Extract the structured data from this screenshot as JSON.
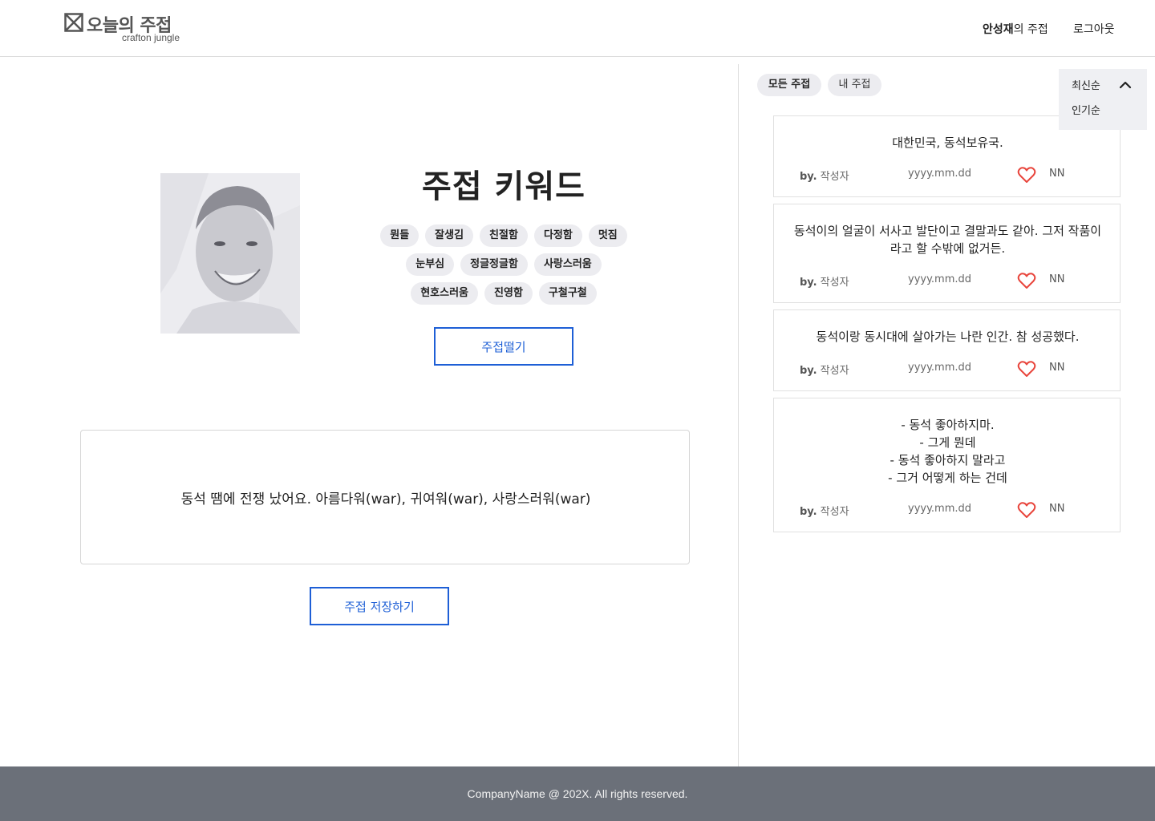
{
  "header": {
    "logo_title": "오늘의 주접",
    "logo_subtitle": "crafton jungle",
    "user_name": "안성재",
    "user_suffix": "의 주접",
    "logout_label": "로그아웃"
  },
  "main": {
    "keyword_title": "주접 키워드",
    "keyword_rows": [
      [
        "뭔들",
        "잘생김",
        "친절함",
        "다정함",
        "멋짐"
      ],
      [
        "눈부심",
        "정글정글함",
        "사랑스러움"
      ],
      [
        "현호스러움",
        "진영함",
        "구철구철"
      ]
    ],
    "generate_button": "주접떨기",
    "fortune_text": "동석  땜에 전쟁 났어요. 아름다워(war), 귀여워(war), 사랑스러워(war)",
    "save_button": "주접 저장하기"
  },
  "sidebar": {
    "tabs": [
      "모든 주접",
      "내 주접"
    ],
    "active_tab": "모든 주접",
    "sort": {
      "selected": "최신순",
      "options": [
        "최신순",
        "인기순"
      ]
    },
    "cards": [
      {
        "lines": [
          "대한민국, 동석보유국."
        ],
        "by": "by.",
        "author": "작성자",
        "date": "yyyy.mm.dd",
        "likes": "NN"
      },
      {
        "lines": [
          "동석이의 얼굴이 서사고 발단이고 결말과도 같아. 그저 작품이",
          "라고 할 수밖에 없거든."
        ],
        "by": "by.",
        "author": "작성자",
        "date": "yyyy.mm.dd",
        "likes": "NN"
      },
      {
        "lines": [
          "동석이랑 동시대에 살아가는 나란 인간. 참 성공했다."
        ],
        "by": "by.",
        "author": "작성자",
        "date": "yyyy.mm.dd",
        "likes": "NN"
      },
      {
        "lines": [
          "- 동석 좋아하지마.",
          "- 그게 뭔데",
          "- 동석 좋아하지 말라고",
          "- 그거 어떻게 하는 건데"
        ],
        "by": "by.",
        "author": "작성자",
        "date": "yyyy.mm.dd",
        "likes": "NN"
      }
    ]
  },
  "footer": {
    "copyright": "CompanyName @ 202X. All rights reserved."
  },
  "colors": {
    "accent": "#1e5fd6",
    "heart": "#e8453c",
    "chip_bg": "#ececf0",
    "footer_bg": "#6b7079"
  }
}
